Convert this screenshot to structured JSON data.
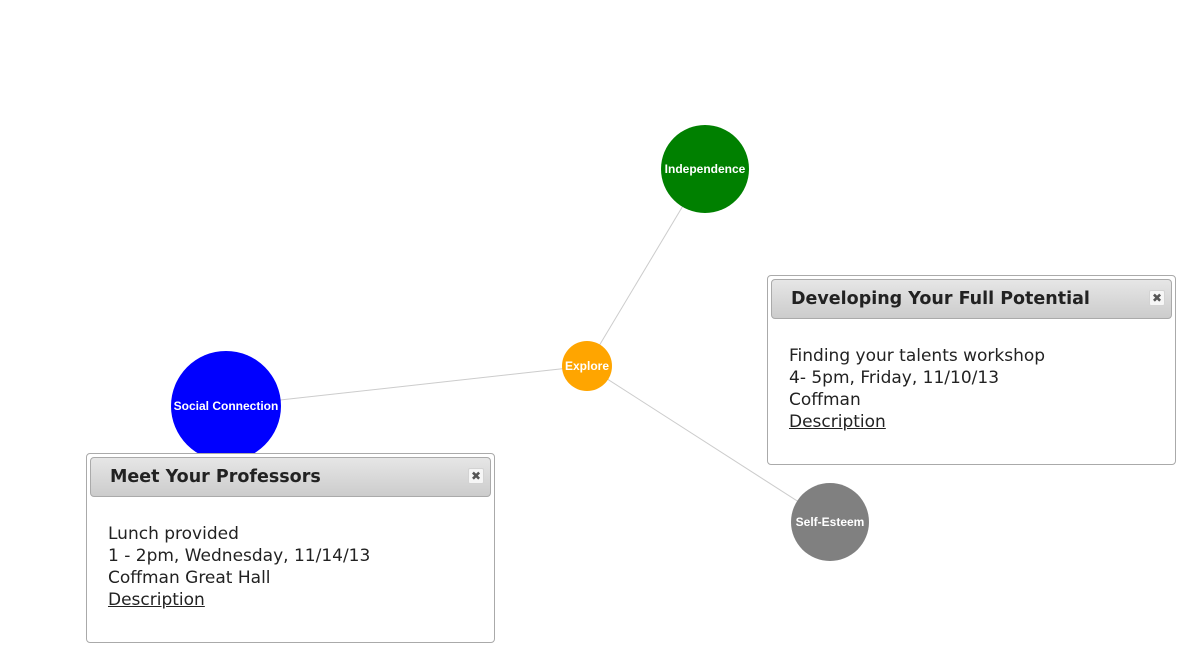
{
  "graph": {
    "nodes": [
      {
        "id": "explore",
        "label": "Explore",
        "color": "#FFA500"
      },
      {
        "id": "independence",
        "label": "Independence",
        "color": "#008000"
      },
      {
        "id": "social",
        "label": "Social Connection",
        "color": "#0000FF"
      },
      {
        "id": "selfesteem",
        "label": "Self-Esteem",
        "color": "#808080"
      }
    ],
    "edge_color": "#cccccc"
  },
  "popups": [
    {
      "title": "Developing Your Full Potential",
      "lines": [
        "Finding your talents workshop",
        "4- 5pm, Friday, 11/10/13",
        "Coffman"
      ],
      "link": "Description",
      "close_icon": "close-icon"
    },
    {
      "title": "Meet Your Professors",
      "lines": [
        "Lunch provided",
        "1 - 2pm, Wednesday, 11/14/13",
        "Coffman Great Hall"
      ],
      "link": "Description",
      "close_icon": "close-icon"
    }
  ]
}
